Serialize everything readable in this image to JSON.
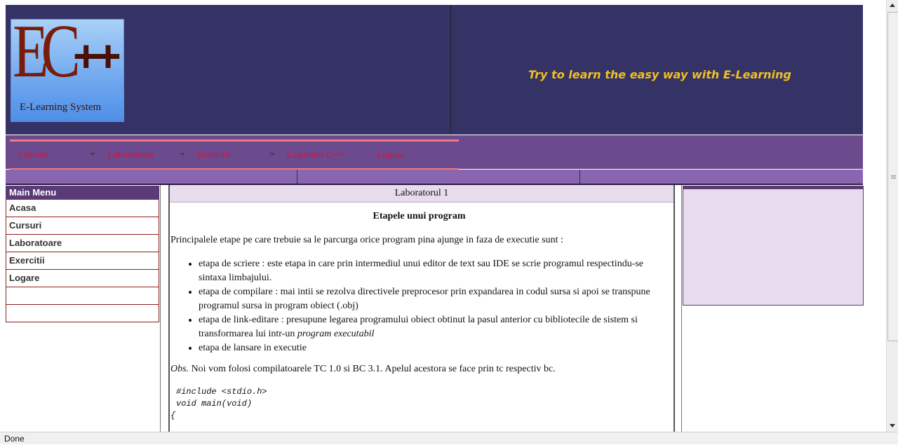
{
  "header": {
    "logo_text": "EC++",
    "logo_subtitle": "E-Learning System",
    "tagline": "Try to learn the easy way with E-Learning"
  },
  "nav": {
    "items": [
      {
        "label": "Cursuri",
        "has_dropdown": true
      },
      {
        "label": "Laboratoare",
        "has_dropdown": true
      },
      {
        "label": "Exercitii",
        "has_dropdown": true
      },
      {
        "label": "Copilator C++",
        "has_dropdown": false
      },
      {
        "label": "Logare",
        "has_dropdown": false
      }
    ]
  },
  "main_menu": {
    "title": "Main Menu",
    "items": [
      "Acasa",
      "Cursuri",
      "Laboratoare",
      "Exercitii",
      "Logare",
      "",
      ""
    ]
  },
  "content": {
    "header": "Laboratorul 1",
    "title": "Etapele unui program",
    "intro": "Principalele etape pe care trebuie sa le parcurga orice program pina ajunge in faza de executie sunt :",
    "steps": [
      "etapa de scriere : este etapa in care prin intermediul unui editor de text sau IDE se scrie programul respectindu-se sintaxa limbajului.",
      "etapa de compilare : mai intii se rezolva directivele preprocesor prin expandarea in codul sursa si apoi se transpune programul sursa in program obiect (.obj)",
      "etapa de link-editare : presupune legarea programului obiect obtinut la pasul anterior cu bibliotecile de sistem si transformarea lui intr-un",
      "etapa de lansare in executie"
    ],
    "step3_emphasis": "program executabil",
    "obs_label": "Obs.",
    "obs_text": " Noi vom folosi compilatoarele TC 1.0 si BC 3.1. Apelul acestora se face prin tc respectiv bc.",
    "code": [
      "#include <stdio.h>",
      "void main(void)",
      "{"
    ]
  },
  "status": {
    "text": "Done"
  },
  "colors": {
    "header_bg": "#353266",
    "tagline": "#f0c020",
    "nav_bg": "#6b4a8e",
    "nav_text": "#e01030",
    "menu_title_bg": "#5b3a78",
    "panel_bg": "#e6dcee"
  }
}
